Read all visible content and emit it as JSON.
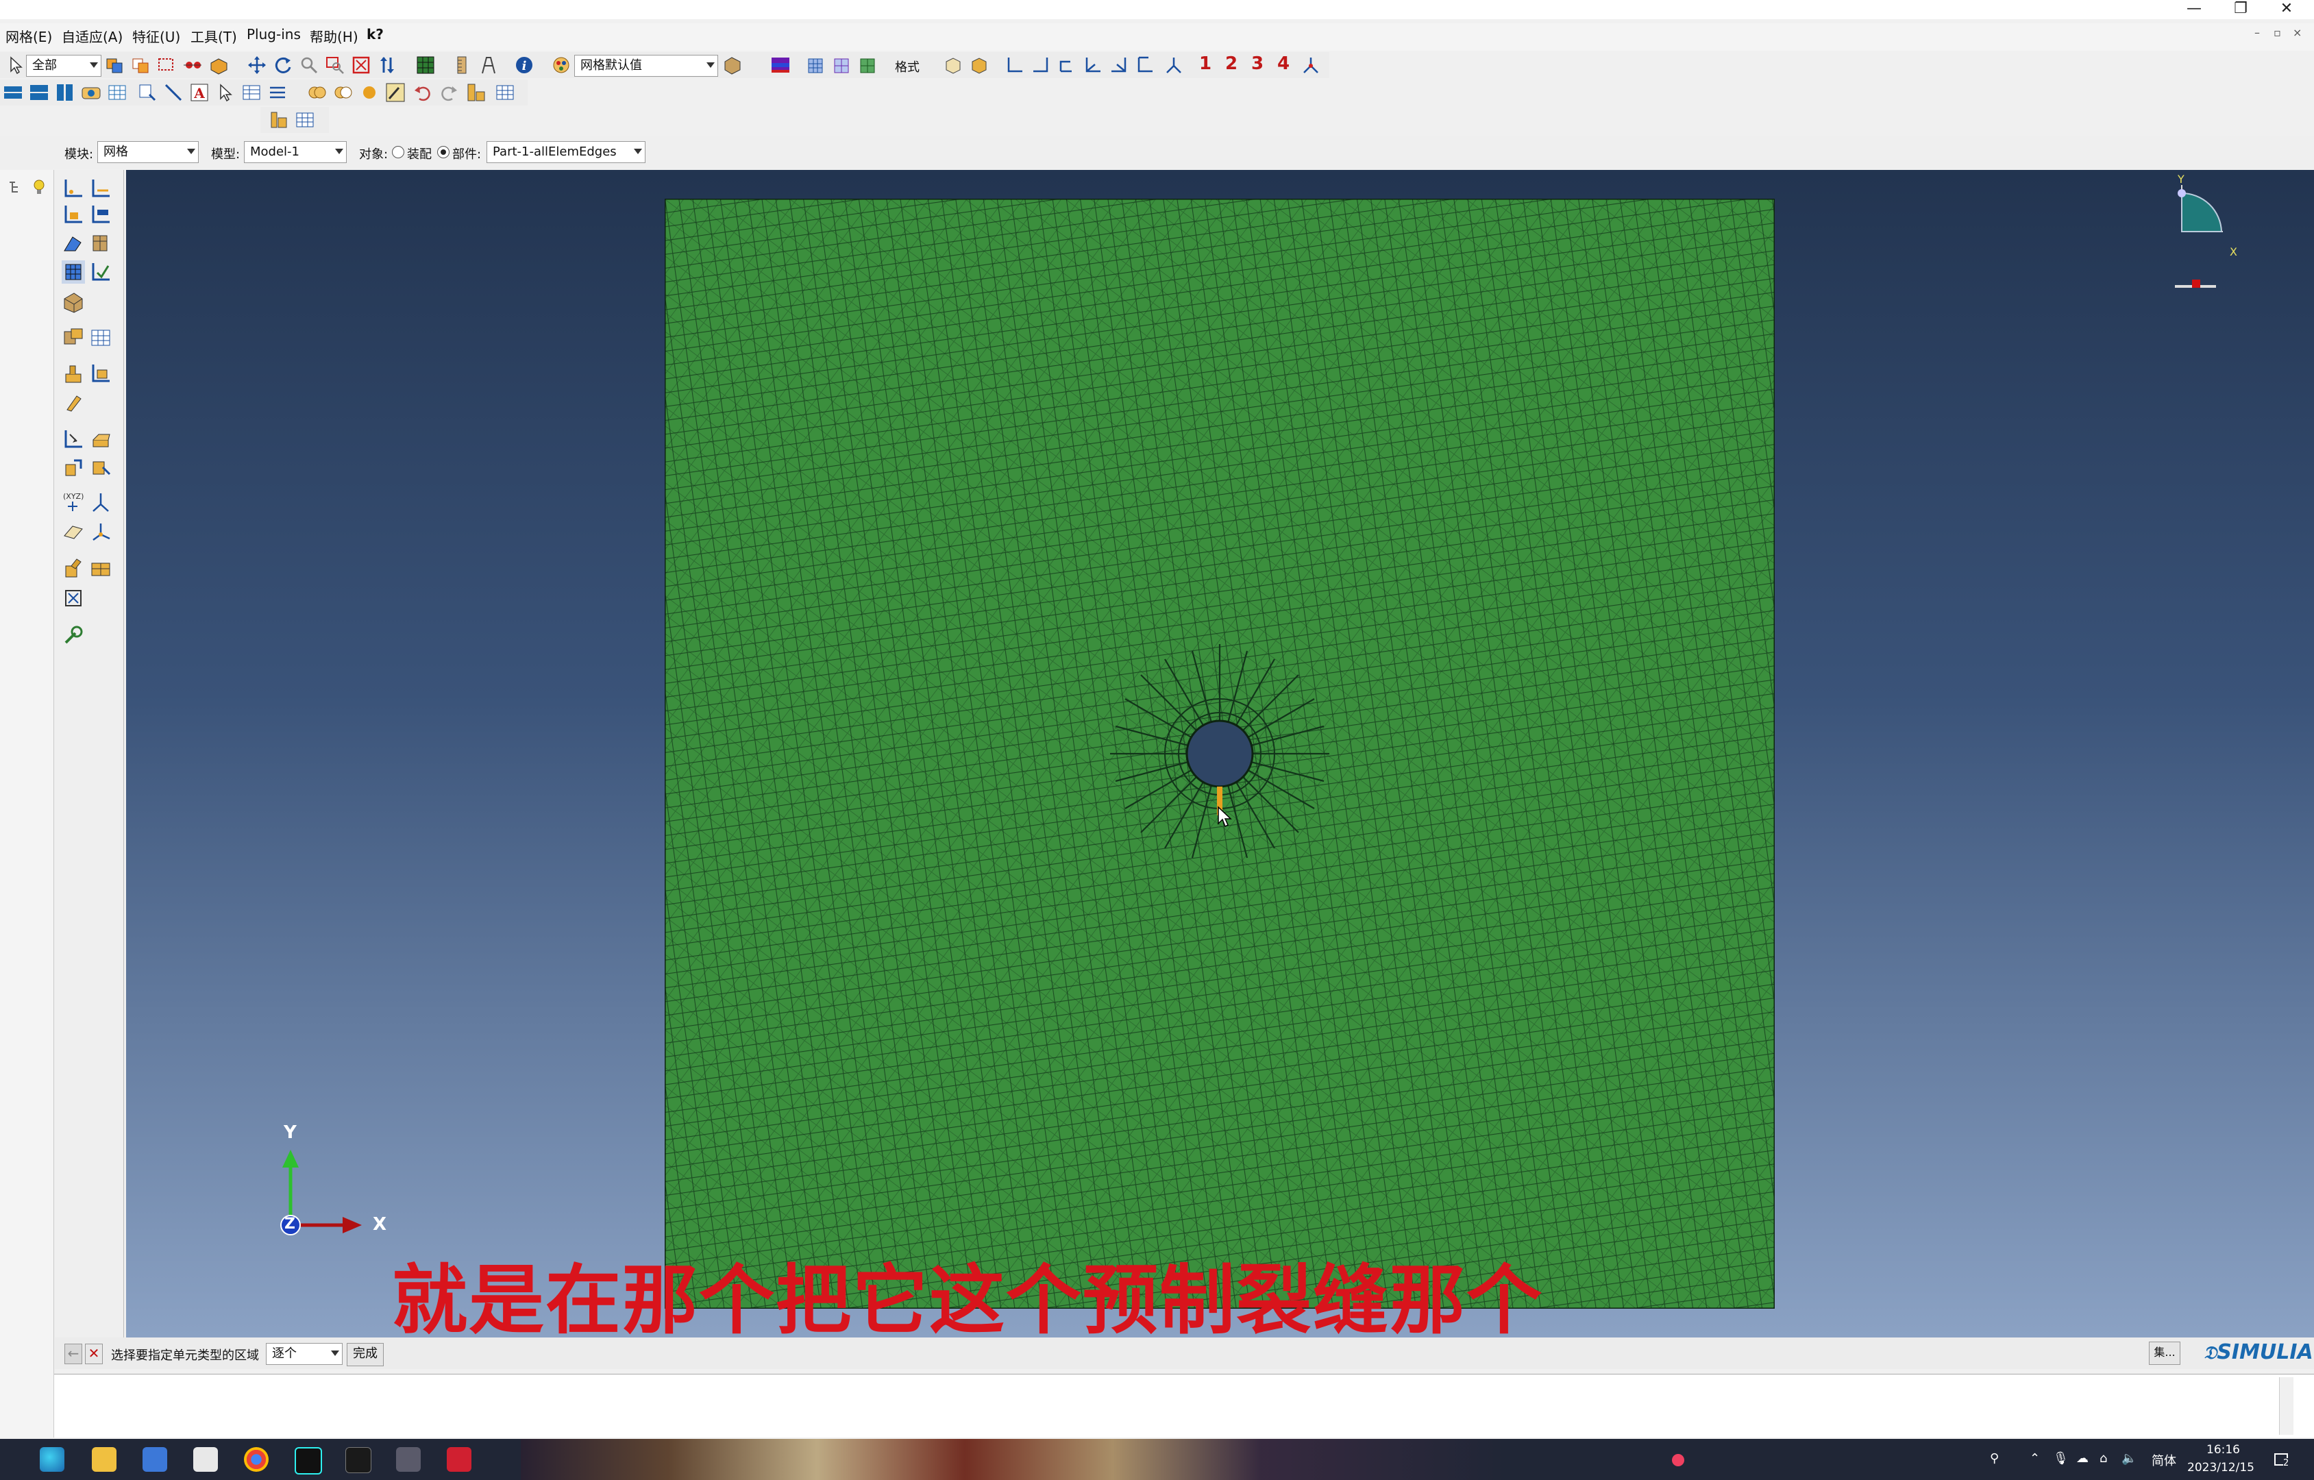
{
  "window": {
    "minimize_symbol": "—",
    "restore_symbol": "❐",
    "close_symbol": "✕"
  },
  "menubar": {
    "items": [
      "网格(E)",
      "自适应(A)",
      "特征(U)",
      "工具(T)",
      "Plug-ins",
      "帮助(H)",
      "k?"
    ],
    "mdi_buttons": [
      "–",
      "▫",
      "×"
    ]
  },
  "toolbar": {
    "selection_filter": "全部",
    "mesh_defaults": "网格默认值",
    "format_label": "格式",
    "numbers": [
      "1",
      "2",
      "3",
      "4"
    ]
  },
  "context_bar": {
    "module_label": "模块:",
    "module_value": "网格",
    "model_label": "模型:",
    "model_value": "Model-1",
    "object_label": "对象:",
    "assembly_label": "装配",
    "part_label": "部件:",
    "part_value": "Part-1-allElemEdges",
    "object_selected": "part"
  },
  "viewport": {
    "triad_y": "Y",
    "triad_x": "X",
    "triad_z": "Z",
    "view_cube_y": "Y",
    "view_cube_x": "X",
    "mesh_color": "#3b8f3d",
    "background_top": "#223450",
    "background_bottom": "#8ba2c4"
  },
  "prompt": {
    "text": "选择要指定单元类型的区域",
    "select_mode": "逐个",
    "done_label": "完成",
    "sets_label": "集..."
  },
  "brand": {
    "text": "SIMULIA"
  },
  "subtitle": {
    "text": "就是在那个把它这个预制裂缝那个"
  },
  "taskbar": {
    "time": "16:16",
    "date": "2023/12/15",
    "ime": "简体",
    "notification_count": "2"
  }
}
